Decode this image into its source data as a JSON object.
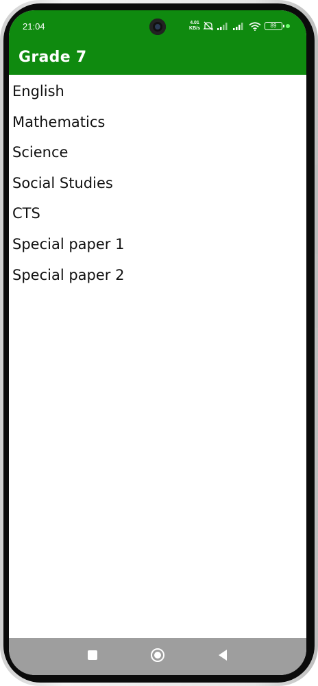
{
  "status_bar": {
    "time": "21:04",
    "net_speed_value": "4.01",
    "net_speed_unit": "KB/s",
    "battery_level": "89",
    "icons": [
      "camera-icon",
      "mute-icon",
      "signal-icon-1",
      "signal-icon-2",
      "wifi-icon",
      "battery-icon",
      "active-dot-icon"
    ]
  },
  "app_bar": {
    "title": "Grade 7",
    "color": "#0f8a0f"
  },
  "subjects": [
    {
      "label": "English"
    },
    {
      "label": "Mathematics"
    },
    {
      "label": "Science"
    },
    {
      "label": "Social Studies"
    },
    {
      "label": "CTS"
    },
    {
      "label": "Special paper 1"
    },
    {
      "label": "Special paper 2"
    }
  ],
  "nav_bar": {
    "buttons": [
      "recent-apps-icon",
      "home-icon",
      "back-icon"
    ],
    "color": "#9e9e9e"
  }
}
